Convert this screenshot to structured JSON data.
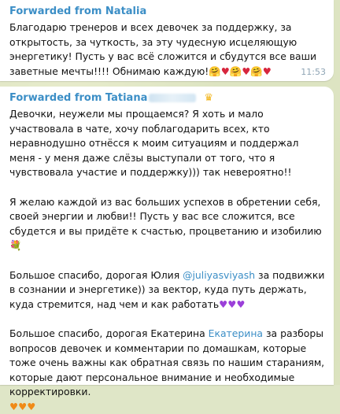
{
  "messages": [
    {
      "forwarded_label": "Forwarded from Natalia",
      "text": "Благодарю тренеров и всех девочек за поддержку, за открытость, за чуткость, за эту чудесную исцеляющую энергетику! Пусть у вас всё сложится и сбудутся все ваши заветные мечты!!!!  Обнимаю каждую!",
      "trailing_emoji": [
        "🤗",
        "♥",
        "🤗",
        "♥",
        "🤗",
        "♥"
      ],
      "time": "11:53"
    },
    {
      "forwarded_label": "Forwarded from Tatiana",
      "header_icon": "crown-icon",
      "paragraph_1": "Девочки, неужели мы прощаемся? Я хоть и мало участвовала в чате, хочу поблагодарить всех, кто неравнодушно отнёсся к моим ситуациям и поддержал меня - у меня даже слёзы выступали от того, что я чувствовала участие и поддержку))) так невероятно!!",
      "paragraph_2": "Я желаю каждой из вас больших успехов в обретении себя, своей энергии и любви!! Пусть у вас все сложится, все сбудется и вы придёте к счастью, процветанию и изобилию",
      "paragraph_2_emoji": "💐",
      "paragraph_3_before": "Большое спасибо, дорогая Юлия ",
      "paragraph_3_mention": "@juliyasviyash",
      "paragraph_3_after": " за подвижки в сознании и энергетике)) за вектор, куда путь держать, куда стремится, над чем и как работать",
      "paragraph_3_emoji": [
        "♥",
        "♥",
        "♥"
      ],
      "paragraph_4_before": "Большое спасибо, дорогая Екатерина ",
      "paragraph_4_mention": "Екатерина",
      "paragraph_4_after": " за разборы вопросов девочек и комментарии по домашкам, которые тоже очень важны как обратная связь по нашим стараниям, которые дают персональное внимание и необходимые корректировки.",
      "paragraph_4_emoji": [
        "♥",
        "♥",
        "♥"
      ]
    }
  ],
  "colors": {
    "accent": "#3b8ec6",
    "bubble": "#ffffff",
    "chat_background": "#dde4c2"
  }
}
